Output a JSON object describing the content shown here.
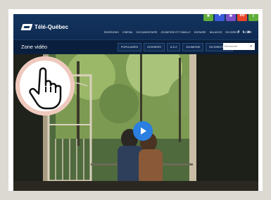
{
  "site": {
    "logo_text": "Télé-Québec",
    "nav": [
      "ÉMISSIONS",
      "CINÉMA",
      "DOCUMENTAIRE",
      "JEUNESSE ET FAMILLE",
      "HORAIRE",
      "BALADOS",
      "EN DIRECT",
      "VIDÉO"
    ],
    "social": [
      "f",
      "t",
      "in"
    ],
    "badges": [
      {
        "label": "★",
        "color": "#5fae3a"
      },
      {
        "label": "♥",
        "color": "#3a5bd9"
      },
      {
        "label": "★",
        "color": "#7a4fc7"
      },
      {
        "label": "ilo",
        "color": "#e8462a"
      },
      {
        "label": "|",
        "color": "#5fae3a"
      }
    ]
  },
  "subbar": {
    "title": "Zone vidéo",
    "pills": [
      "POPULAIRES",
      "DOSSIERS",
      "À À Z",
      "JEUNESSE"
    ],
    "live_label": "EN DIRECT",
    "search_placeholder": "Recherche"
  },
  "video": {
    "play_icon": "play-icon",
    "cursor_icon": "hand-pointer-icon"
  },
  "colors": {
    "header": "#13345f",
    "play": "#2a7fe0",
    "cursor_ring": "#efc9bd"
  }
}
